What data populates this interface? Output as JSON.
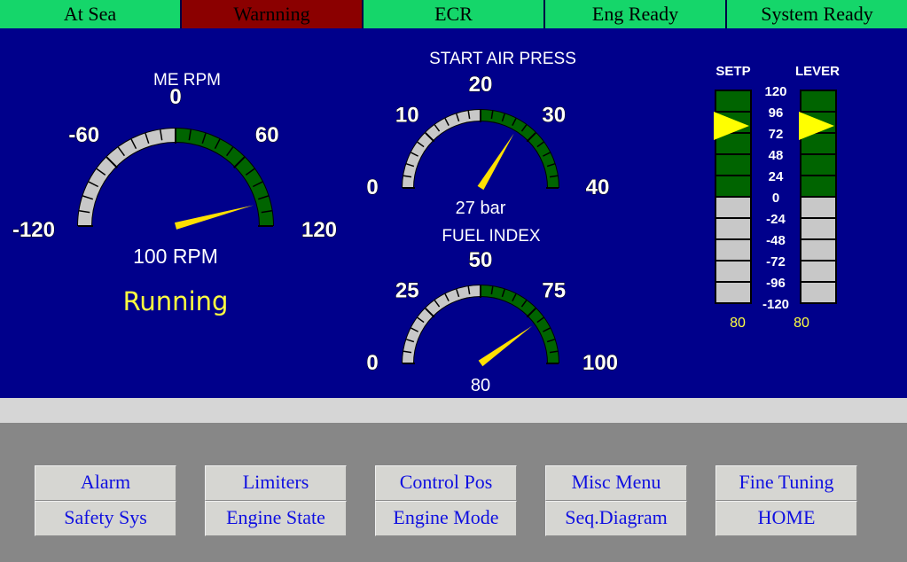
{
  "status_bar": [
    {
      "label": "At Sea",
      "color": "#15d66a"
    },
    {
      "label": "Warnning",
      "color": "#8b0000"
    },
    {
      "label": "ECR",
      "color": "#15d66a"
    },
    {
      "label": "Eng Ready",
      "color": "#15d66a"
    },
    {
      "label": "System Ready",
      "color": "#15d66a"
    }
  ],
  "gauges": {
    "me_rpm": {
      "title": "ME RPM",
      "ticks": [
        "-120",
        "-60",
        "0",
        "60",
        "120"
      ],
      "min": -120,
      "max": 120,
      "green_from": 0,
      "value": 100,
      "readout": "100 RPM",
      "state": "Running"
    },
    "start_air": {
      "title": "START AIR PRESS",
      "ticks": [
        "0",
        "10",
        "20",
        "30",
        "40"
      ],
      "min": 0,
      "max": 40,
      "green_from": 20,
      "value": 27,
      "readout": "27 bar"
    },
    "fuel_index": {
      "title": "FUEL INDEX",
      "ticks": [
        "0",
        "25",
        "50",
        "75",
        "100"
      ],
      "min": 0,
      "max": 100,
      "green_from": 50,
      "value": 80,
      "readout": "80"
    }
  },
  "bars": {
    "scale": [
      "120",
      "96",
      "72",
      "48",
      "24",
      "0",
      "-24",
      "-48",
      "-72",
      "-96",
      "-120"
    ],
    "setp": {
      "title": "SETP",
      "value": 80,
      "readout": "80"
    },
    "lever": {
      "title": "LEVER",
      "value": 80,
      "readout": "80"
    }
  },
  "colors": {
    "panel": "#00008b",
    "green": "#006400",
    "grey": "#c8c8c8",
    "needle": "#ffe000",
    "readout_yellow": "#ffff40"
  },
  "menu": [
    [
      "Alarm",
      "Safety Sys"
    ],
    [
      "Limiters",
      "Engine State"
    ],
    [
      "Control Pos",
      "Engine Mode"
    ],
    [
      "Misc Menu",
      "Seq.Diagram"
    ],
    [
      "Fine Tuning",
      "HOME"
    ]
  ]
}
